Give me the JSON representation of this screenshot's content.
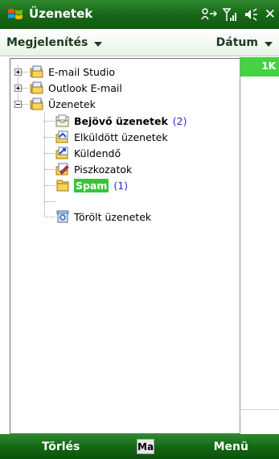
{
  "titlebar": {
    "title": "Üzenetek",
    "icons": [
      "windows-flag-icon",
      "connectivity-icon",
      "signal-icon",
      "volume-icon",
      "close-icon"
    ],
    "close_glyph": "✕"
  },
  "header": {
    "view_menu": "Megjelenítés",
    "sort_menu": "Dátum"
  },
  "right_pane": {
    "label": "1K",
    "accent_color": "#45d245"
  },
  "tree": {
    "items": [
      {
        "label": "E-mail Studio",
        "icon": "account-folder-icon",
        "expander": "plus"
      },
      {
        "label": "Outlook E-mail",
        "icon": "account-folder-icon",
        "expander": "plus"
      },
      {
        "label": "Üzenetek",
        "icon": "account-folder-icon",
        "expander": "minus"
      },
      {
        "label": "Bejövő üzenetek",
        "icon": "inbox-icon",
        "count": "(2)",
        "bold": true
      },
      {
        "label": "Elküldött üzenetek",
        "icon": "sent-items-icon"
      },
      {
        "label": "Küldendő",
        "icon": "outbox-icon"
      },
      {
        "label": "Piszkozatok",
        "icon": "drafts-icon"
      },
      {
        "label": "Spam",
        "icon": "folder-icon",
        "count": "(1)",
        "selected": true
      },
      {
        "label": "Törölt üzenetek",
        "icon": "deleted-items-icon"
      }
    ]
  },
  "bottombar": {
    "left_softkey": "Törlés",
    "input_indicator": "Ma",
    "right_softkey": "Menü"
  }
}
